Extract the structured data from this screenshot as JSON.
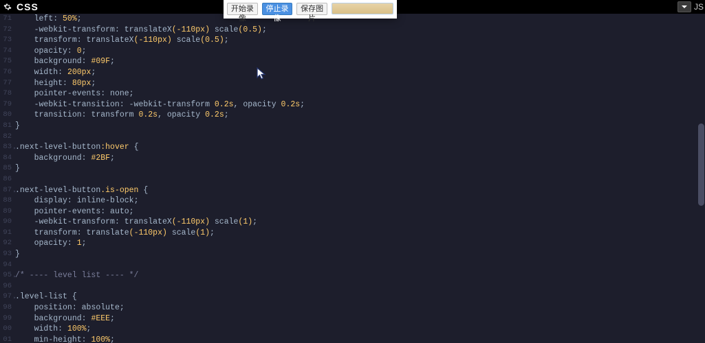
{
  "tabBar": {
    "title": "CSS",
    "rightTab": "JS"
  },
  "popup": {
    "startRec": "开始录像",
    "stopRec": "停止录像",
    "saveImg": "保存图片"
  },
  "lines": [
    {
      "n": "71",
      "tokens": [
        [
          "sp",
          "    "
        ],
        [
          "prop",
          "left"
        ],
        [
          "punc",
          ": "
        ],
        [
          "num",
          "50%"
        ],
        [
          "punc",
          ";"
        ]
      ]
    },
    {
      "n": "72",
      "tokens": [
        [
          "sp",
          "    "
        ],
        [
          "prop",
          "-webkit-transform"
        ],
        [
          "punc",
          ": "
        ],
        [
          "ident",
          "translateX"
        ],
        [
          "yp",
          "("
        ],
        [
          "num",
          "-110px"
        ],
        [
          "yp",
          ")"
        ],
        [
          "punc",
          " "
        ],
        [
          "ident",
          "scale"
        ],
        [
          "yp",
          "("
        ],
        [
          "num",
          "0.5"
        ],
        [
          "yp",
          ")"
        ],
        [
          "punc",
          ";"
        ]
      ]
    },
    {
      "n": "73",
      "tokens": [
        [
          "sp",
          "    "
        ],
        [
          "prop",
          "transform"
        ],
        [
          "punc",
          ": "
        ],
        [
          "ident",
          "translateX"
        ],
        [
          "yp",
          "("
        ],
        [
          "num",
          "-110px"
        ],
        [
          "yp",
          ")"
        ],
        [
          "punc",
          " "
        ],
        [
          "ident",
          "scale"
        ],
        [
          "yp",
          "("
        ],
        [
          "num",
          "0.5"
        ],
        [
          "yp",
          ")"
        ],
        [
          "punc",
          ";"
        ]
      ]
    },
    {
      "n": "74",
      "tokens": [
        [
          "sp",
          "    "
        ],
        [
          "prop",
          "opacity"
        ],
        [
          "punc",
          ": "
        ],
        [
          "num",
          "0"
        ],
        [
          "punc",
          ";"
        ]
      ]
    },
    {
      "n": "75",
      "tokens": [
        [
          "sp",
          "    "
        ],
        [
          "prop",
          "background"
        ],
        [
          "punc",
          ": "
        ],
        [
          "num",
          "#09F"
        ],
        [
          "punc",
          ";"
        ]
      ]
    },
    {
      "n": "76",
      "tokens": [
        [
          "sp",
          "    "
        ],
        [
          "prop",
          "width"
        ],
        [
          "punc",
          ": "
        ],
        [
          "num",
          "200px"
        ],
        [
          "punc",
          ";"
        ]
      ]
    },
    {
      "n": "77",
      "tokens": [
        [
          "sp",
          "    "
        ],
        [
          "prop",
          "height"
        ],
        [
          "punc",
          ": "
        ],
        [
          "num",
          "80px"
        ],
        [
          "punc",
          ";"
        ]
      ]
    },
    {
      "n": "78",
      "tokens": [
        [
          "sp",
          "    "
        ],
        [
          "prop",
          "pointer-events"
        ],
        [
          "punc",
          ": "
        ],
        [
          "ident",
          "none"
        ],
        [
          "punc",
          ";"
        ]
      ]
    },
    {
      "n": "79",
      "tokens": [
        [
          "sp",
          "    "
        ],
        [
          "prop",
          "-webkit-transition"
        ],
        [
          "punc",
          ": "
        ],
        [
          "ident",
          "-webkit-"
        ],
        [
          "prop",
          "transform"
        ],
        [
          "punc",
          " "
        ],
        [
          "num",
          "0.2s"
        ],
        [
          "punc",
          ", "
        ],
        [
          "ident",
          "opacity"
        ],
        [
          "punc",
          " "
        ],
        [
          "num",
          "0.2s"
        ],
        [
          "punc",
          ";"
        ]
      ]
    },
    {
      "n": "80",
      "tokens": [
        [
          "sp",
          "    "
        ],
        [
          "prop",
          "transition"
        ],
        [
          "punc",
          ": "
        ],
        [
          "ident",
          "transform"
        ],
        [
          "punc",
          " "
        ],
        [
          "num",
          "0.2s"
        ],
        [
          "punc",
          ", "
        ],
        [
          "ident",
          "opacity"
        ],
        [
          "punc",
          " "
        ],
        [
          "num",
          "0.2s"
        ],
        [
          "punc",
          ";"
        ]
      ]
    },
    {
      "n": "81",
      "tokens": [
        [
          "brace",
          "}"
        ]
      ]
    },
    {
      "n": "82",
      "tokens": []
    },
    {
      "n": "83",
      "mark": true,
      "tokens": [
        [
          "sel",
          ".next-level-button"
        ],
        [
          "pseudo",
          ":hover"
        ],
        [
          "punc",
          " "
        ],
        [
          "brace",
          "{"
        ]
      ]
    },
    {
      "n": "84",
      "tokens": [
        [
          "sp",
          "    "
        ],
        [
          "prop",
          "background"
        ],
        [
          "punc",
          ": "
        ],
        [
          "num",
          "#2BF"
        ],
        [
          "punc",
          ";"
        ]
      ]
    },
    {
      "n": "85",
      "tokens": [
        [
          "brace",
          "}"
        ]
      ]
    },
    {
      "n": "86",
      "tokens": []
    },
    {
      "n": "87",
      "mark": true,
      "tokens": [
        [
          "sel",
          ".next-level-button"
        ],
        [
          "pseudo",
          ".is-open"
        ],
        [
          "punc",
          " "
        ],
        [
          "brace",
          "{"
        ]
      ]
    },
    {
      "n": "88",
      "tokens": [
        [
          "sp",
          "    "
        ],
        [
          "prop",
          "display"
        ],
        [
          "punc",
          ": "
        ],
        [
          "ident",
          "inline-block"
        ],
        [
          "punc",
          ";"
        ]
      ]
    },
    {
      "n": "89",
      "tokens": [
        [
          "sp",
          "    "
        ],
        [
          "prop",
          "pointer-events"
        ],
        [
          "punc",
          ": "
        ],
        [
          "ident",
          "auto"
        ],
        [
          "punc",
          ";"
        ]
      ]
    },
    {
      "n": "90",
      "tokens": [
        [
          "sp",
          "    "
        ],
        [
          "prop",
          "-webkit-transform"
        ],
        [
          "punc",
          ": "
        ],
        [
          "ident",
          "translateX"
        ],
        [
          "yp",
          "("
        ],
        [
          "num",
          "-110px"
        ],
        [
          "yp",
          ")"
        ],
        [
          "punc",
          " "
        ],
        [
          "ident",
          "scale"
        ],
        [
          "yp",
          "("
        ],
        [
          "num",
          "1"
        ],
        [
          "yp",
          ")"
        ],
        [
          "punc",
          ";"
        ]
      ]
    },
    {
      "n": "91",
      "tokens": [
        [
          "sp",
          "    "
        ],
        [
          "prop",
          "transform"
        ],
        [
          "punc",
          ": "
        ],
        [
          "ident",
          "translate"
        ],
        [
          "yp",
          "("
        ],
        [
          "num",
          "-110px"
        ],
        [
          "yp",
          ")"
        ],
        [
          "punc",
          " "
        ],
        [
          "ident",
          "scale"
        ],
        [
          "yp",
          "("
        ],
        [
          "num",
          "1"
        ],
        [
          "yp",
          ")"
        ],
        [
          "punc",
          ";"
        ]
      ]
    },
    {
      "n": "92",
      "tokens": [
        [
          "sp",
          "    "
        ],
        [
          "prop",
          "opacity"
        ],
        [
          "punc",
          ": "
        ],
        [
          "num",
          "1"
        ],
        [
          "punc",
          ";"
        ]
      ]
    },
    {
      "n": "93",
      "tokens": [
        [
          "brace",
          "}"
        ]
      ]
    },
    {
      "n": "94",
      "tokens": []
    },
    {
      "n": "95",
      "mark": true,
      "tokens": [
        [
          "comment",
          "/* ---- level list ---- */"
        ]
      ]
    },
    {
      "n": "96",
      "tokens": []
    },
    {
      "n": "97",
      "mark": true,
      "tokens": [
        [
          "sel",
          ".level-list"
        ],
        [
          "punc",
          " "
        ],
        [
          "brace",
          "{"
        ]
      ]
    },
    {
      "n": "98",
      "tokens": [
        [
          "sp",
          "    "
        ],
        [
          "prop",
          "position"
        ],
        [
          "punc",
          ": "
        ],
        [
          "ident",
          "absolute"
        ],
        [
          "punc",
          ";"
        ]
      ]
    },
    {
      "n": "99",
      "tokens": [
        [
          "sp",
          "    "
        ],
        [
          "prop",
          "background"
        ],
        [
          "punc",
          ": "
        ],
        [
          "num",
          "#EEE"
        ],
        [
          "punc",
          ";"
        ]
      ]
    },
    {
      "n": "00",
      "tokens": [
        [
          "sp",
          "    "
        ],
        [
          "prop",
          "width"
        ],
        [
          "punc",
          ": "
        ],
        [
          "num",
          "100%"
        ],
        [
          "punc",
          ";"
        ]
      ]
    },
    {
      "n": "01",
      "tokens": [
        [
          "sp",
          "    "
        ],
        [
          "prop",
          "min-height"
        ],
        [
          "punc",
          ": "
        ],
        [
          "num",
          "100%"
        ],
        [
          "punc",
          ";"
        ]
      ]
    }
  ]
}
